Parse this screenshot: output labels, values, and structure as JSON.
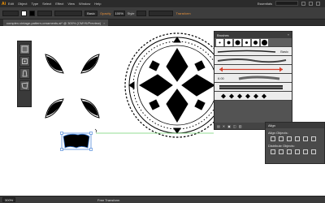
{
  "app": {
    "logo": "Ai"
  },
  "menu": {
    "items": [
      "Edit",
      "Object",
      "Type",
      "Select",
      "Effect",
      "View",
      "Window",
      "Help"
    ],
    "workspace": "Essentials"
  },
  "control_bar": {
    "stroke_label": "Basic",
    "opacity_label": "Opacity",
    "opacity_value": "100%",
    "style_label": "Style",
    "transform_label": "Transform",
    "colors": {
      "fill": "#ffffff",
      "stroke": "#000000",
      "accent": "#e8913a"
    }
  },
  "document": {
    "tab_title": "complex-vintage-pattern-ornaments.ai* @ 300% (CMYK/Preview)",
    "close_glyph": "×"
  },
  "brushes_panel": {
    "title": "Brushes",
    "basic_label": "Basic",
    "size_label": "6.00",
    "close_glyph": "«"
  },
  "align_panel": {
    "title": "Align",
    "align_objects": "Align Objects:",
    "distribute_objects": "Distribute Objects:"
  },
  "status_bar": {
    "zoom": "300%",
    "current_tool": "Free Transform"
  }
}
